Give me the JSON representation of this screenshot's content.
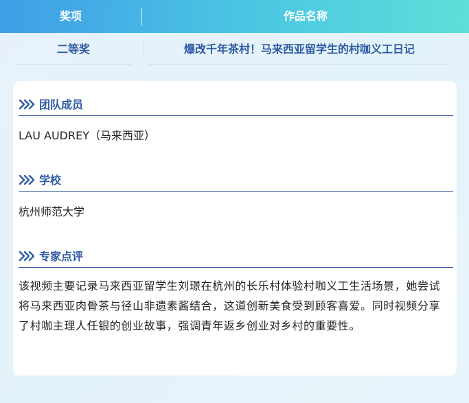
{
  "table": {
    "header": {
      "award": "奖项",
      "title": "作品名称"
    },
    "row": {
      "award": "二等奖",
      "title": "爆改千年茶村！马来西亚留学生的村咖义工日记"
    }
  },
  "sections": [
    {
      "heading": "团队成员",
      "body": "LAU AUDREY（马来西亚）"
    },
    {
      "heading": "学校",
      "body": "杭州师范大学"
    },
    {
      "heading": "专家点评",
      "body": "该视频主要记录马来西亚留学生刘璟在杭州的长乐村体验村咖义工生活场景，她尝试将马来西亚肉骨茶与径山非遗素酱结合，这道创新美食受到顾客喜爱。同时视频分享了村咖主理人任银的创业故事，强调青年返乡创业对乡村的重要性。"
    }
  ],
  "icons": {
    "section_marker": "triple-chevron-icon"
  },
  "colors": {
    "accent": "#2f5aa3",
    "header_start": "#3f9ee6",
    "header_end": "#5de0d8"
  }
}
